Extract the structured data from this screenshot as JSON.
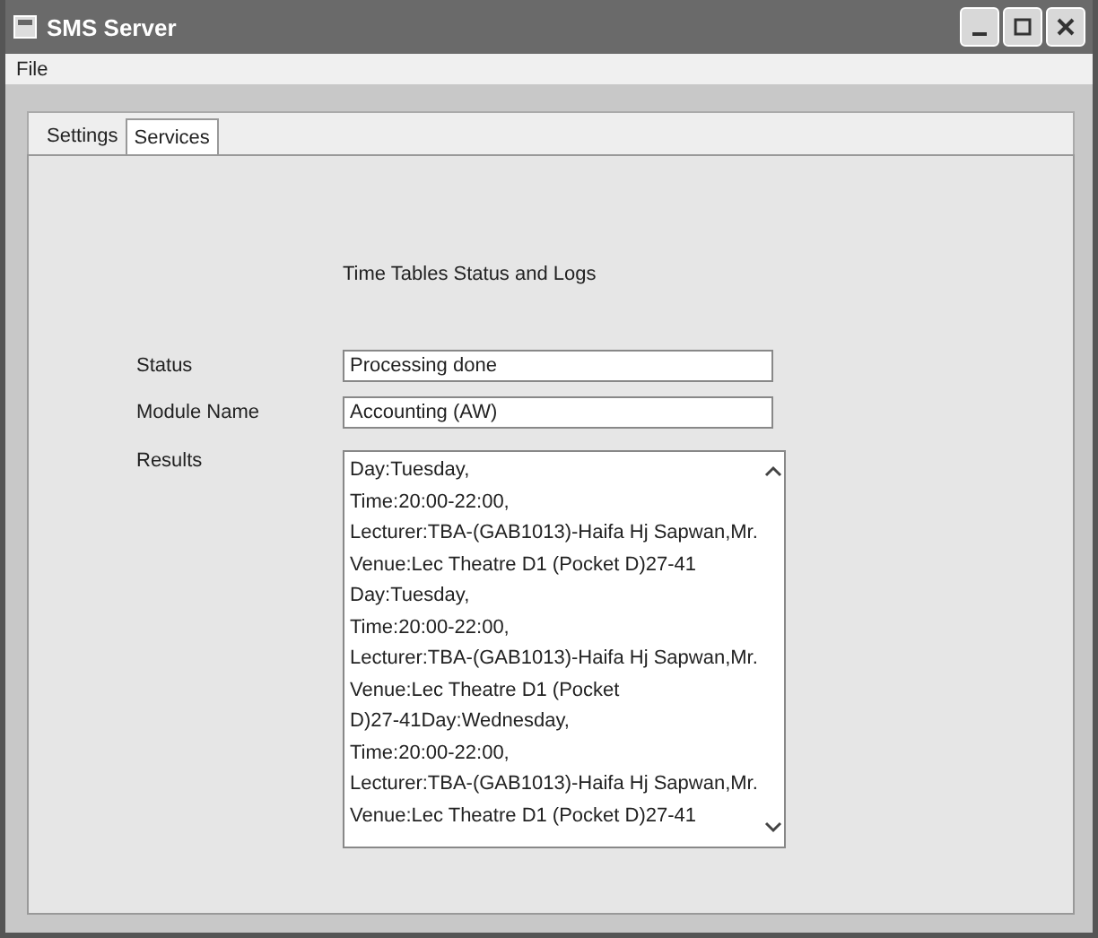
{
  "window": {
    "title": "SMS Server"
  },
  "menu": [
    "File"
  ],
  "tabs": [
    {
      "label": "Settings",
      "selected": false
    },
    {
      "label": "Services",
      "selected": true
    }
  ],
  "heading": "Time Tables Status and Logs",
  "fields": [
    {
      "label": "Status",
      "value": "Processing done"
    },
    {
      "label": "Module Name",
      "value": "Accounting (AW)"
    }
  ],
  "results": {
    "label": "Results",
    "lines": [
      "Day:Tuesday,",
      "Time:20:00-22:00,",
      "Lecturer:TBA-(GAB1013)-Haifa Hj Sapwan,Mr.",
      "Venue:Lec Theatre D1 (Pocket D)27-41",
      "Day:Tuesday,",
      "Time:20:00-22:00,",
      "Lecturer:TBA-(GAB1013)-Haifa Hj Sapwan,Mr.",
      "Venue:Lec Theatre D1 (Pocket",
      "D)27-41Day:Wednesday,",
      "Time:20:00-22:00,",
      "Lecturer:TBA-(GAB1013)-Haifa Hj Sapwan,Mr.",
      "Venue:Lec Theatre D1 (Pocket D)27-41"
    ]
  }
}
